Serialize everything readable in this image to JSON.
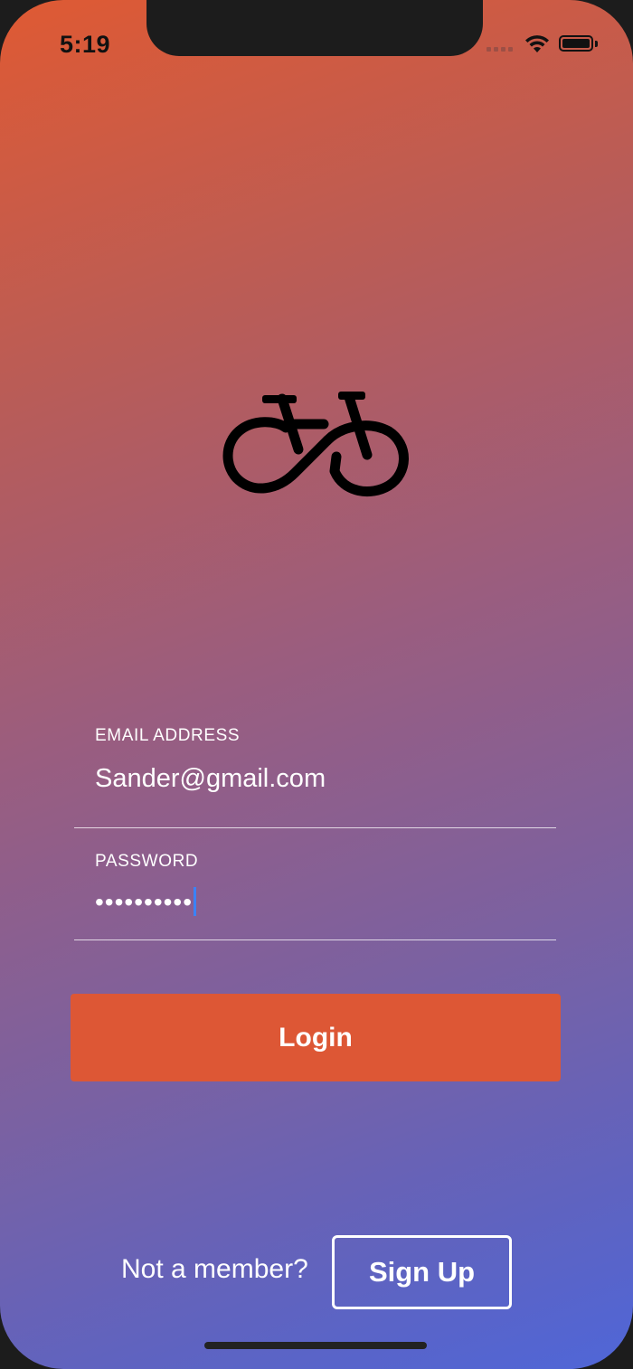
{
  "status_bar": {
    "time": "5:19",
    "icons": [
      "cellular-signal-icon",
      "wifi-icon",
      "battery-icon"
    ]
  },
  "logo": {
    "icon": "bicycle-icon"
  },
  "form": {
    "email_label": "EMAIL ADDRESS",
    "email_value": "Sander@gmail.com",
    "password_label": "PASSWORD",
    "password_value": "••••••••••"
  },
  "login_button": {
    "label": "Login"
  },
  "footer": {
    "prompt": "Not a member?",
    "signup_label": "Sign Up"
  },
  "colors": {
    "gradient_top": "#df5a33",
    "gradient_bottom": "#4f66d8",
    "login_button": "#dd5735",
    "caret": "#3b82f6"
  }
}
